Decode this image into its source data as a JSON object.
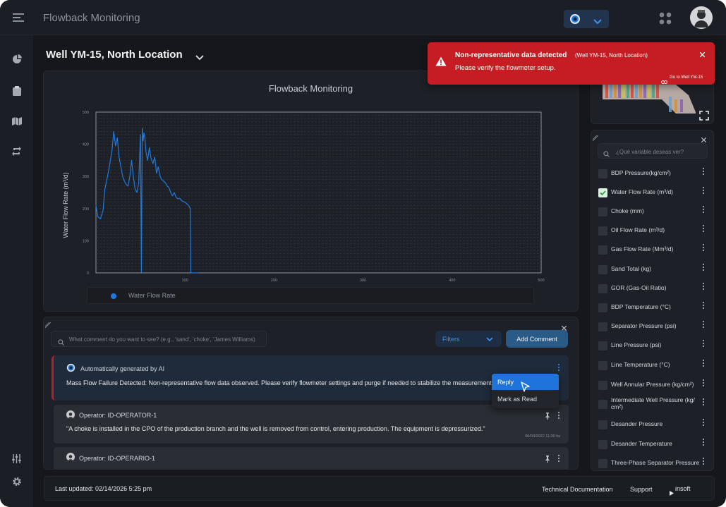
{
  "app": {
    "title": "Flowback Monitoring"
  },
  "well": {
    "title": "Well YM-15, North Location"
  },
  "chart_data": {
    "type": "line",
    "title": "Flowback Monitoring",
    "ylabel": "Water Flow Rate (m³/d)",
    "xlabel": "",
    "xlim": [
      0,
      500
    ],
    "ylim": [
      0,
      500
    ],
    "x_ticks": [
      100,
      200,
      300,
      400,
      500
    ],
    "y_ticks": [
      0,
      100,
      200,
      300,
      400,
      500
    ],
    "grid": true,
    "legend": "bottom",
    "series": [
      {
        "name": "Water Flow Rate",
        "color": "#1f7ae0",
        "x": [
          0,
          2,
          5,
          8,
          10,
          13,
          15,
          18,
          20,
          22,
          24,
          26,
          28,
          30,
          32,
          34,
          36,
          38,
          40,
          42,
          44,
          46,
          48,
          50,
          51,
          52,
          53,
          54,
          55,
          56,
          58,
          60,
          62,
          64,
          66,
          68,
          70,
          72,
          74,
          76,
          78,
          80,
          82,
          84,
          86,
          88,
          90,
          92,
          94,
          96,
          98,
          100,
          102,
          104,
          106,
          106.5,
          107,
          108,
          110,
          112,
          115
        ],
        "y": [
          210,
          175,
          168,
          195,
          260,
          300,
          330,
          380,
          440,
          395,
          420,
          360,
          330,
          300,
          285,
          275,
          270,
          300,
          350,
          300,
          260,
          250,
          280,
          430,
          2,
          450,
          410,
          435,
          420,
          380,
          350,
          390,
          355,
          340,
          360,
          310,
          330,
          300,
          290,
          285,
          280,
          270,
          265,
          250,
          240,
          250,
          235,
          230,
          232,
          225,
          222,
          220,
          215,
          210,
          200,
          3,
          0,
          0,
          0,
          0,
          0
        ]
      }
    ]
  },
  "toast": {
    "title": "Non-representative data detected",
    "context": "(Well YM-15, North Location)",
    "message": "Please verify the flowmeter setup.",
    "link": "Go to Well YM-15"
  },
  "variables": {
    "search_placeholder": "¿Qué variable deseas ver?",
    "items": [
      {
        "label": "BDP Pressure(kg/cm²)",
        "checked": false
      },
      {
        "label": "Water Flow Rate (m³/d)",
        "checked": true
      },
      {
        "label": "Choke (mm)",
        "checked": false
      },
      {
        "label": "Oil Flow Rate (m³/d)",
        "checked": false
      },
      {
        "label": "Gas Flow Rate (Mm³/d)",
        "checked": false
      },
      {
        "label": "Sand Total (kg)",
        "checked": false
      },
      {
        "label": "GOR (Gas-Oil Ratio)",
        "checked": false
      },
      {
        "label": "BDP Temperature (°C)",
        "checked": false
      },
      {
        "label": "Separator Pressure (psi)",
        "checked": false
      },
      {
        "label": "Line Pressure (psi)",
        "checked": false
      },
      {
        "label": "Line Temperature (°C)",
        "checked": false
      },
      {
        "label": "Well Annular Pressure (kg/cm²)",
        "checked": false
      },
      {
        "label": "Intermediate Well Pressure (kg/ cm²)",
        "checked": false
      },
      {
        "label": "Desander Pressure",
        "checked": false
      },
      {
        "label": "Desander Temperature",
        "checked": false
      },
      {
        "label": "Three-Phase Separator Pressure",
        "checked": false
      }
    ]
  },
  "comments": {
    "search_placeholder": "What comment do you want to see? (e.g., 'sand', 'choke', 'James Williams)",
    "filters_label": "Filters",
    "add_label": "Add Comment",
    "ai": {
      "author": "Automatically generated by AI",
      "text": "Mass Flow Failure Detected: Non-representative flow data observed. Please verify flowmeter settings and purge if needed to stabilize the measurement."
    },
    "menu": {
      "reply": "Reply",
      "mark_read": "Mark as Read"
    },
    "items": [
      {
        "author": "Operator: ID-OPERATOR-1",
        "text": "\"A choke is installed in the CPO of the production branch and the well is removed from control, entering production. The equipment is depressurized.\"",
        "timestamp": "06/03/2022 11:00 hs"
      },
      {
        "author": "Operator: ID-OPERARIO-1",
        "text": "",
        "timestamp": ""
      }
    ]
  },
  "footer": {
    "last_updated": "Last updated: 02/14/2026 5:25 pm",
    "docs": "Technical Documentation",
    "support": "Support",
    "brand": "insoft"
  },
  "colors": {
    "accent": "#1f7ae0",
    "alert": "#c51d23",
    "background": "#15171c"
  }
}
